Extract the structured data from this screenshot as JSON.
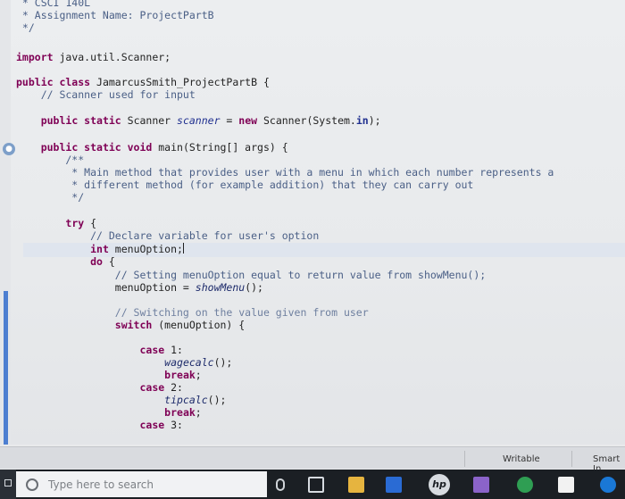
{
  "editor": {
    "lines": [
      {
        "text": " * CSCI 140L"
      },
      {
        "text": " * Assignment Name: ProjectPartB"
      },
      {
        "text": " */"
      },
      {
        "text": "import java.util.Scanner;"
      },
      {
        "text": "public class JamarcusSmith_ProjectPartB {"
      },
      {
        "text": "    // Scanner used for input"
      },
      {
        "text": "    public static Scanner scanner = new Scanner(System.in);"
      },
      {
        "text": "    public static void main(String[] args) {"
      },
      {
        "text": "        /**"
      },
      {
        "text": "         * Main method that provides user with a menu in which each number represents a"
      },
      {
        "text": "         * different method (for example addition) that they can carry out"
      },
      {
        "text": "         */"
      },
      {
        "text": "        try {"
      },
      {
        "text": "            // Declare variable for user's option"
      },
      {
        "text": "            int menuOption;"
      },
      {
        "text": "            do {"
      },
      {
        "text": "                // Setting menuOption equal to return value from showMenu();"
      },
      {
        "text": "                menuOption = showMenu();"
      },
      {
        "text": "                // Switching on the value given from user"
      },
      {
        "text": "                switch (menuOption) {"
      },
      {
        "text": "                    case 1:"
      },
      {
        "text": "                        wagecalc();"
      },
      {
        "text": "                        break;"
      },
      {
        "text": "                    case 2:"
      },
      {
        "text": "                        tipcalc();"
      },
      {
        "text": "                        break;"
      },
      {
        "text": "                    case 3:"
      }
    ]
  },
  "status_bar": {
    "writable": "Writable",
    "smart_insert": "Smart In"
  },
  "taskbar": {
    "search_placeholder": "Type here to search",
    "icons": [
      "task-view-icon",
      "file-explorer-icon",
      "store-icon",
      "hp-icon",
      "photos-icon",
      "chrome-icon",
      "mail-icon",
      "edge-icon"
    ]
  },
  "colors": {
    "keyword": "#7f0055",
    "comment": "#4a5f86",
    "field": "#1f2f8f",
    "taskbar": "#1b1f24"
  }
}
